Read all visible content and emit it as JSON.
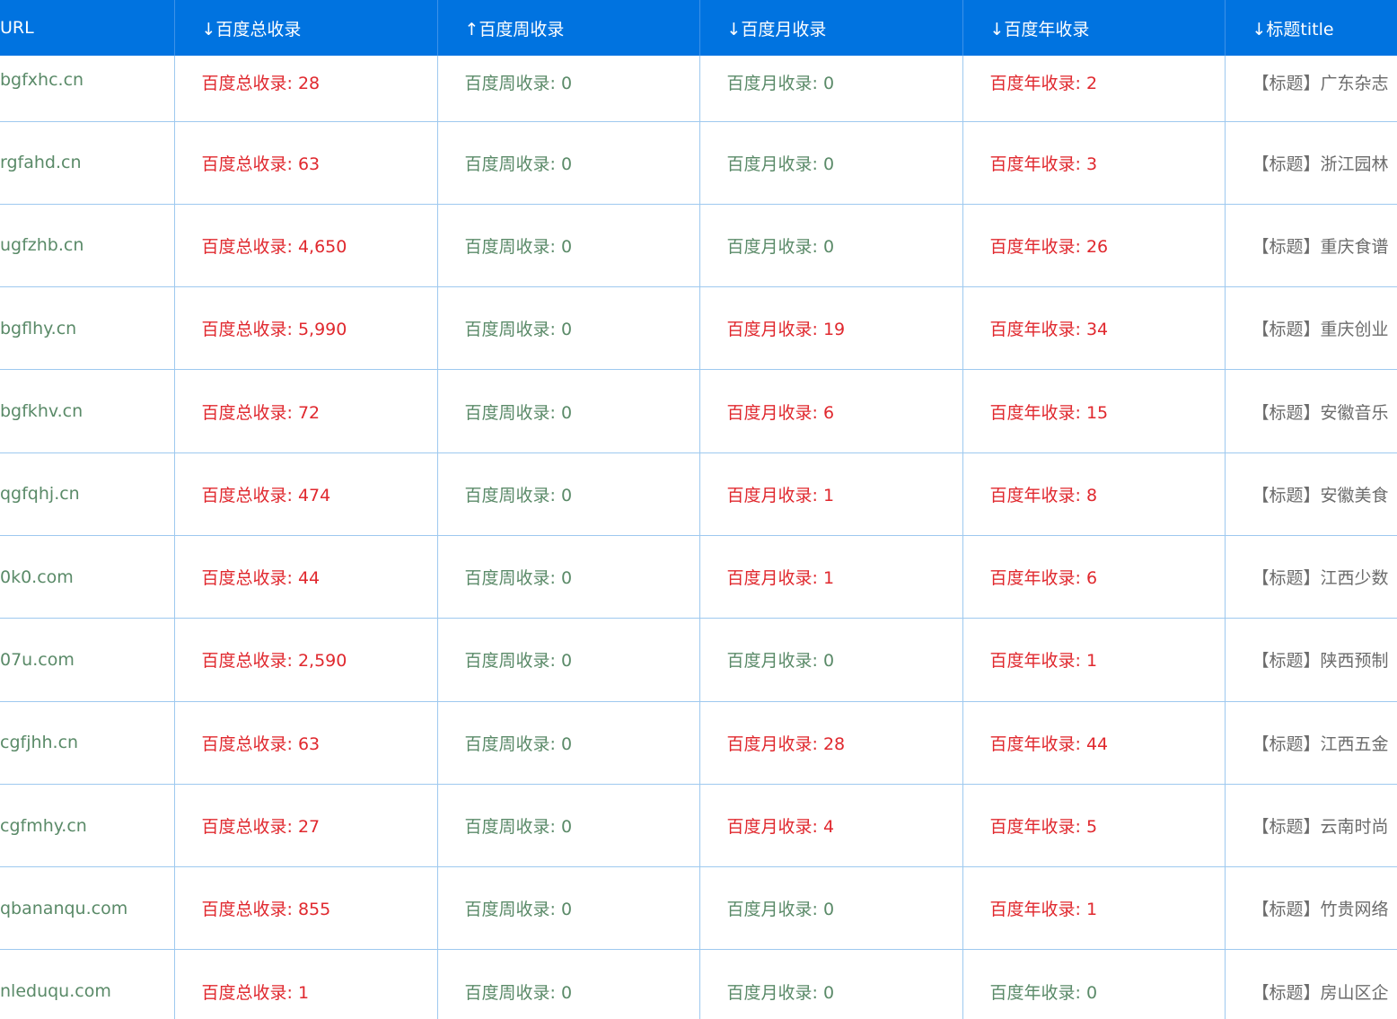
{
  "headers": {
    "url": "URL",
    "total": "↓百度总收录",
    "week": "↑百度周收录",
    "month": "↓百度月收录",
    "year": "↓百度年收录",
    "title": "↓标题title"
  },
  "colors": {
    "header_bg": "#0073e0",
    "highlight": "#e0282e",
    "normal": "#5a8a68",
    "border": "#9ec9ef"
  },
  "rows": [
    {
      "url": "bgfxhc.cn",
      "total": "百度总收录: 28",
      "week": "百度周收录: 0",
      "month": "百度月收录: 0",
      "year": "百度年收录: 2",
      "title": "【标题】广东杂志",
      "hi": {
        "total": true,
        "week": false,
        "month": false,
        "year": true
      }
    },
    {
      "url": "rgfahd.cn",
      "total": "百度总收录: 63",
      "week": "百度周收录: 0",
      "month": "百度月收录: 0",
      "year": "百度年收录: 3",
      "title": "【标题】浙江园林",
      "hi": {
        "total": true,
        "week": false,
        "month": false,
        "year": true
      }
    },
    {
      "url": "ugfzhb.cn",
      "total": "百度总收录: 4,650",
      "week": "百度周收录: 0",
      "month": "百度月收录: 0",
      "year": "百度年收录: 26",
      "title": "【标题】重庆食谱",
      "hi": {
        "total": true,
        "week": false,
        "month": false,
        "year": true
      }
    },
    {
      "url": "bgflhy.cn",
      "total": "百度总收录: 5,990",
      "week": "百度周收录: 0",
      "month": "百度月收录: 19",
      "year": "百度年收录: 34",
      "title": "【标题】重庆创业",
      "hi": {
        "total": true,
        "week": false,
        "month": true,
        "year": true
      }
    },
    {
      "url": "bgfkhv.cn",
      "total": "百度总收录: 72",
      "week": "百度周收录: 0",
      "month": "百度月收录: 6",
      "year": "百度年收录: 15",
      "title": "【标题】安徽音乐",
      "hi": {
        "total": true,
        "week": false,
        "month": true,
        "year": true
      }
    },
    {
      "url": "qgfqhj.cn",
      "total": "百度总收录: 474",
      "week": "百度周收录: 0",
      "month": "百度月收录: 1",
      "year": "百度年收录: 8",
      "title": "【标题】安徽美食",
      "hi": {
        "total": true,
        "week": false,
        "month": true,
        "year": true
      }
    },
    {
      "url": "0k0.com",
      "total": "百度总收录: 44",
      "week": "百度周收录: 0",
      "month": "百度月收录: 1",
      "year": "百度年收录: 6",
      "title": "【标题】江西少数",
      "hi": {
        "total": true,
        "week": false,
        "month": true,
        "year": true
      }
    },
    {
      "url": "07u.com",
      "total": "百度总收录: 2,590",
      "week": "百度周收录: 0",
      "month": "百度月收录: 0",
      "year": "百度年收录: 1",
      "title": "【标题】陕西预制",
      "hi": {
        "total": true,
        "week": false,
        "month": false,
        "year": true
      }
    },
    {
      "url": "cgfjhh.cn",
      "total": "百度总收录: 63",
      "week": "百度周收录: 0",
      "month": "百度月收录: 28",
      "year": "百度年收录: 44",
      "title": "【标题】江西五金",
      "hi": {
        "total": true,
        "week": false,
        "month": true,
        "year": true
      }
    },
    {
      "url": "cgfmhy.cn",
      "total": "百度总收录: 27",
      "week": "百度周收录: 0",
      "month": "百度月收录: 4",
      "year": "百度年收录: 5",
      "title": "【标题】云南时尚",
      "hi": {
        "total": true,
        "week": false,
        "month": true,
        "year": true
      }
    },
    {
      "url": "qbananqu.com",
      "total": "百度总收录: 855",
      "week": "百度周收录: 0",
      "month": "百度月收录: 0",
      "year": "百度年收录: 1",
      "title": "【标题】竹贵网络",
      "hi": {
        "total": true,
        "week": false,
        "month": false,
        "year": true
      }
    },
    {
      "url": "nleduqu.com",
      "total": "百度总收录: 1",
      "week": "百度周收录: 0",
      "month": "百度月收录: 0",
      "year": "百度年收录: 0",
      "title": "【标题】房山区企",
      "hi": {
        "total": true,
        "week": false,
        "month": false,
        "year": false
      }
    }
  ]
}
